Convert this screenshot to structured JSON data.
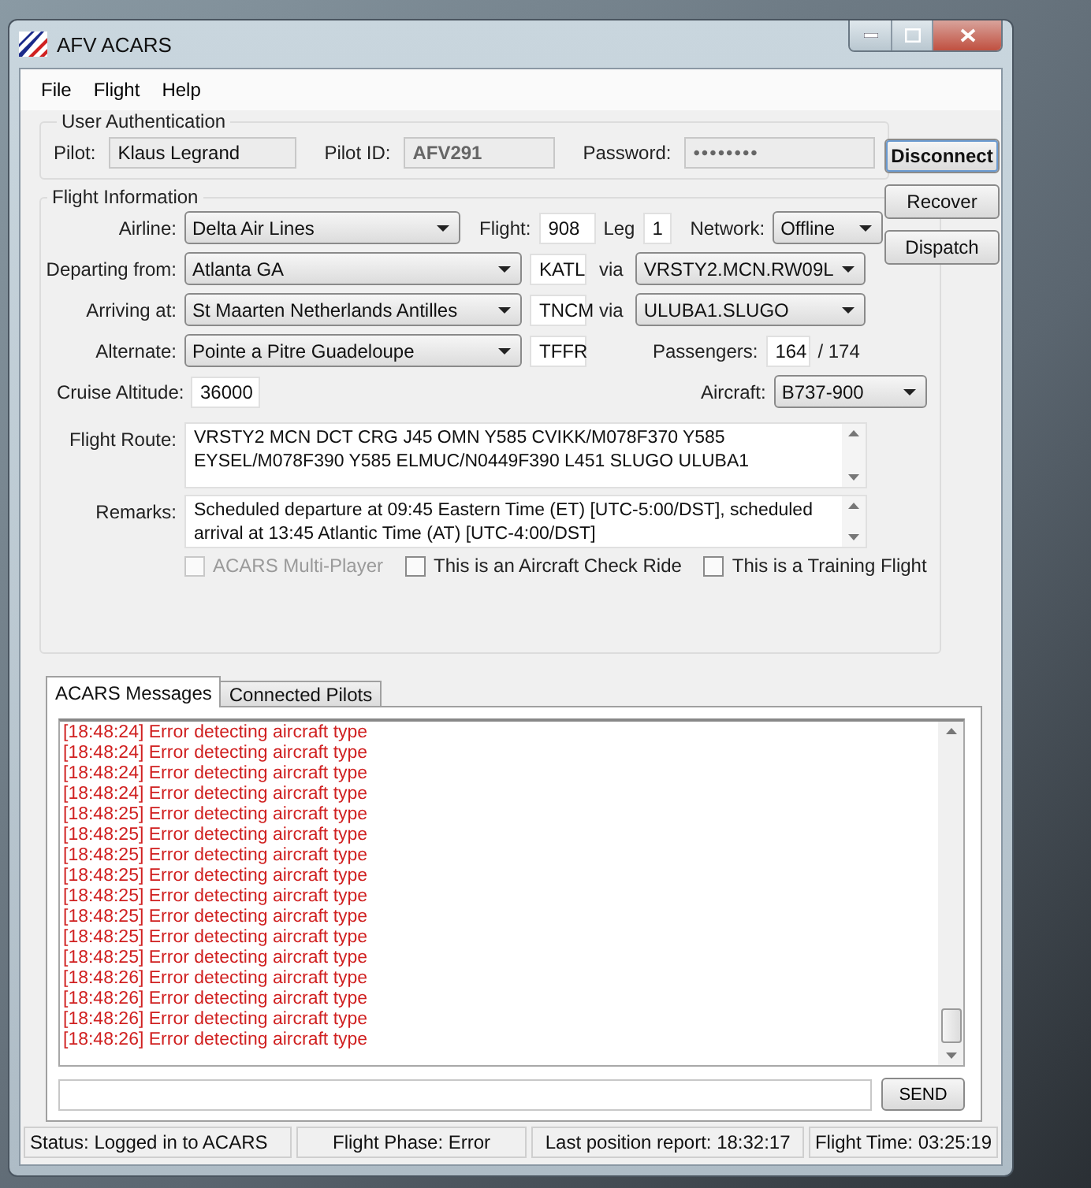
{
  "window": {
    "title": "AFV ACARS"
  },
  "menu": [
    "File",
    "Flight",
    "Help"
  ],
  "user_authentication": {
    "title": "User Authentication",
    "fields": [
      {
        "label": "Pilot:",
        "value": "Klaus Legrand",
        "kind": "text"
      },
      {
        "label": "Pilot ID:",
        "value": "AFV291",
        "kind": "id"
      },
      {
        "label": "Password:",
        "value": "••••••••",
        "kind": "password"
      }
    ]
  },
  "side_buttons": [
    {
      "label": "Disconnect",
      "default": true
    },
    {
      "label": "Recover",
      "default": false
    },
    {
      "label": "Dispatch",
      "default": false
    }
  ],
  "flight_information": {
    "title": "Flight Information",
    "airline": {
      "label": "Airline:",
      "value": "Delta Air Lines"
    },
    "flight": {
      "label": "Flight:",
      "value": "908"
    },
    "leg": {
      "label": "Leg",
      "value": "1"
    },
    "network": {
      "label": "Network:",
      "value": "Offline"
    },
    "airports": [
      {
        "label": "Departing from:",
        "value": "Atlanta GA",
        "code": "KATL",
        "via_label": "via",
        "via": "VRSTY2.MCN.RW09L"
      },
      {
        "label": "Arriving at:",
        "value": "St Maarten Netherlands Antilles",
        "code": "TNCM",
        "via_label": "via",
        "via": "ULUBA1.SLUGO"
      },
      {
        "label": "Alternate:",
        "value": "Pointe a Pitre Guadeloupe",
        "code": "TFFR"
      }
    ],
    "passengers": {
      "label": "Passengers:",
      "value": "164",
      "capacity": "/ 174"
    },
    "cruise_altitude": {
      "label": "Cruise Altitude:",
      "value": "36000"
    },
    "aircraft": {
      "label": "Aircraft:",
      "value": "B737-900"
    },
    "flight_route": {
      "label": "Flight Route:",
      "value": "VRSTY2 MCN DCT CRG J45 OMN Y585 CVIKK/M078F370 Y585  EYSEL/M078F390 Y585 ELMUC/N0449F390 L451 SLUGO ULUBA1"
    },
    "remarks": {
      "label": "Remarks:",
      "value": "Scheduled departure at 09:45 Eastern Time (ET) [UTC-5:00/DST], scheduled arrival at 13:45 Atlantic Time (AT) [UTC-4:00/DST]"
    },
    "options": [
      {
        "label": "ACARS Multi-Player",
        "checked": false,
        "disabled": true
      },
      {
        "label": "This is an Aircraft Check Ride",
        "checked": false,
        "disabled": false
      },
      {
        "label": "This is a Training Flight",
        "checked": false,
        "disabled": false
      }
    ]
  },
  "tabs": [
    {
      "label": "ACARS Messages",
      "selected": true
    },
    {
      "label": "Connected Pilots",
      "selected": false
    }
  ],
  "messages": [
    {
      "time": "[18:48:24]",
      "text": "Error detecting aircraft type"
    },
    {
      "time": "[18:48:24]",
      "text": "Error detecting aircraft type"
    },
    {
      "time": "[18:48:24]",
      "text": "Error detecting aircraft type"
    },
    {
      "time": "[18:48:24]",
      "text": "Error detecting aircraft type"
    },
    {
      "time": "[18:48:25]",
      "text": "Error detecting aircraft type"
    },
    {
      "time": "[18:48:25]",
      "text": "Error detecting aircraft type"
    },
    {
      "time": "[18:48:25]",
      "text": "Error detecting aircraft type"
    },
    {
      "time": "[18:48:25]",
      "text": "Error detecting aircraft type"
    },
    {
      "time": "[18:48:25]",
      "text": "Error detecting aircraft type"
    },
    {
      "time": "[18:48:25]",
      "text": "Error detecting aircraft type"
    },
    {
      "time": "[18:48:25]",
      "text": "Error detecting aircraft type"
    },
    {
      "time": "[18:48:25]",
      "text": "Error detecting aircraft type"
    },
    {
      "time": "[18:48:26]",
      "text": "Error detecting aircraft type"
    },
    {
      "time": "[18:48:26]",
      "text": "Error detecting aircraft type"
    },
    {
      "time": "[18:48:26]",
      "text": "Error detecting aircraft type"
    },
    {
      "time": "[18:48:26]",
      "text": "Error detecting aircraft type"
    }
  ],
  "send_button": "SEND",
  "status_bar": [
    "Status: Logged in to ACARS",
    "Flight Phase: Error",
    "Last position report: 18:32:17",
    "Flight Time: 03:25:19"
  ]
}
